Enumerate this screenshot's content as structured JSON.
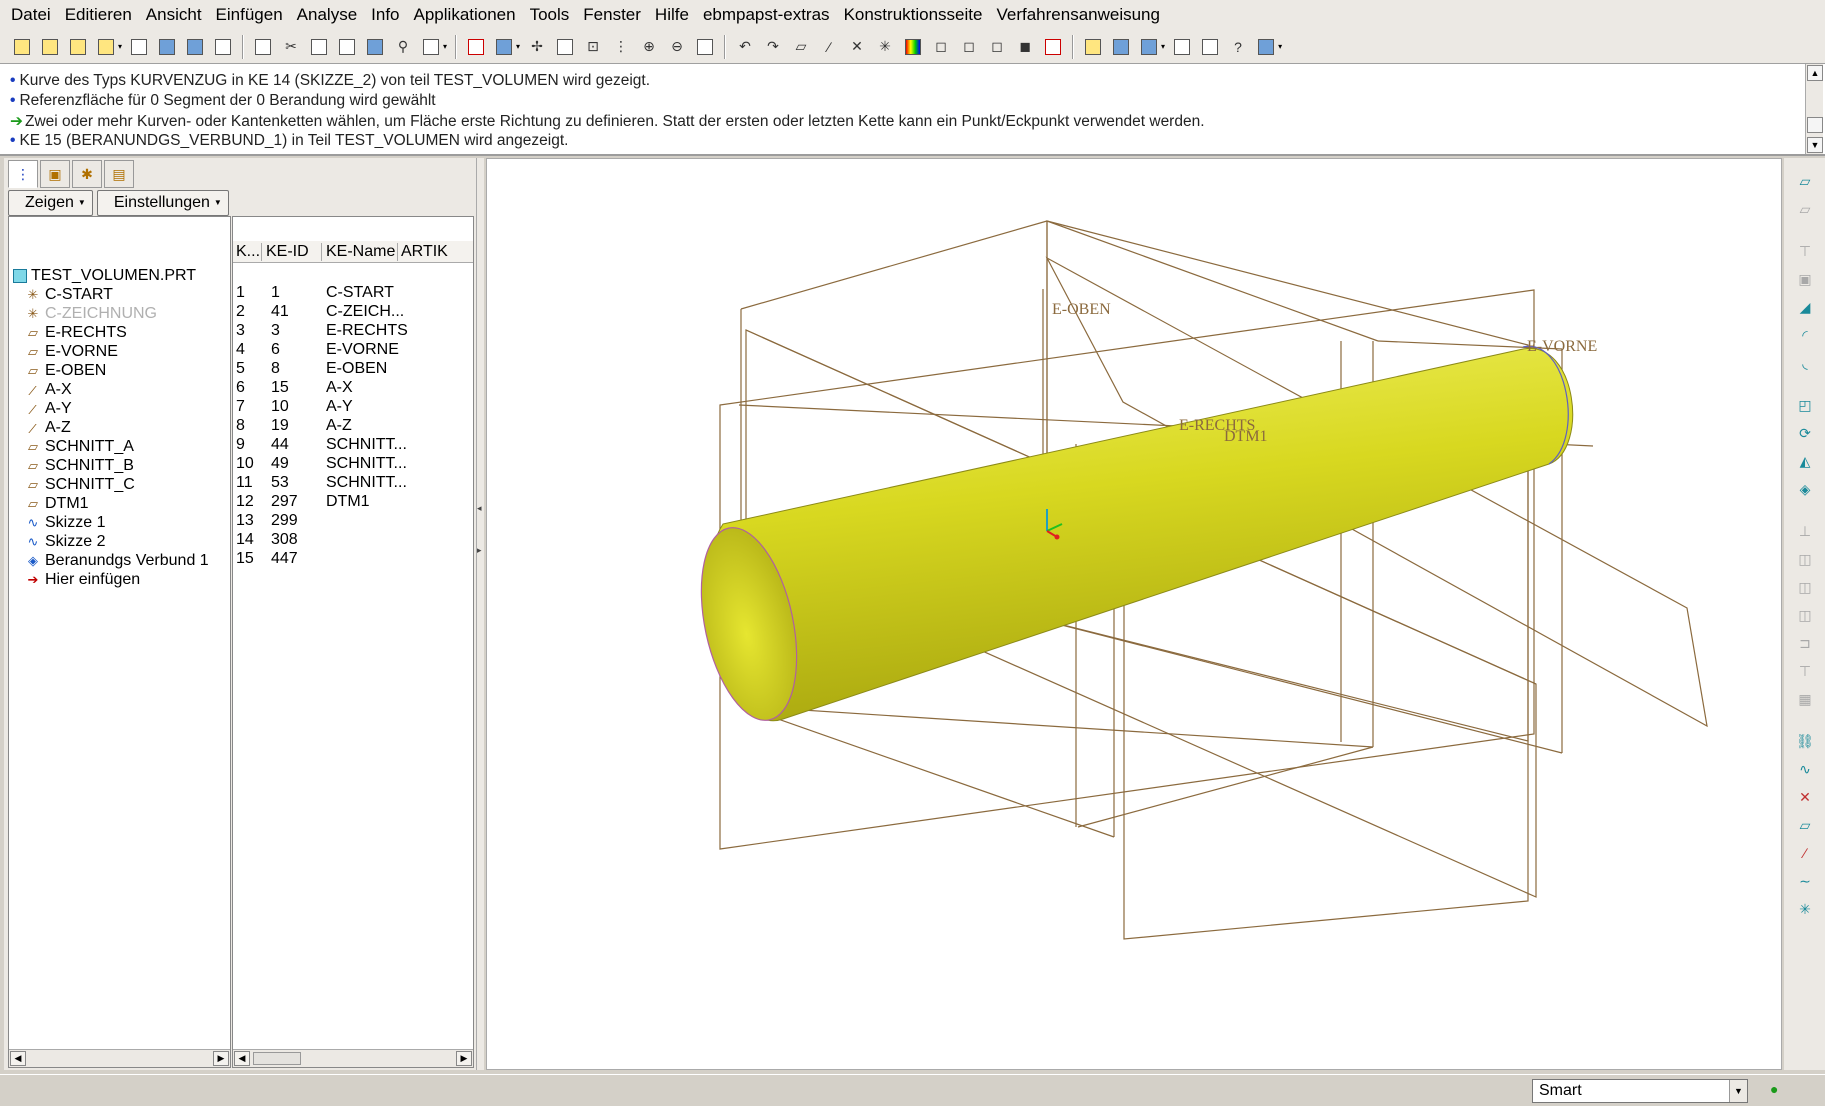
{
  "menu": [
    "Datei",
    "Editieren",
    "Ansicht",
    "Einfügen",
    "Analyse",
    "Info",
    "Applikationen",
    "Tools",
    "Fenster",
    "Hilfe",
    "ebmpapst-extras",
    "Konstruktionsseite",
    "Verfahrensanweisung"
  ],
  "messages": [
    {
      "marker": "•",
      "text": "Kurve des Typs KURVENZUG in KE 14 (SKIZZE_2) von teil TEST_VOLUMEN wird gezeigt."
    },
    {
      "marker": "•",
      "text": "Referenzfläche für 0 Segment der 0 Berandung wird gewählt"
    },
    {
      "marker": "arrow",
      "text": "Zwei oder mehr Kurven- oder Kantenketten wählen, um Fläche erste Richtung zu definieren. Statt der ersten oder letzten Kette kann ein Punkt/Eckpunkt verwendet werden."
    },
    {
      "marker": "•",
      "text": "KE 15 (BERANUNDGS_VERBUND_1) in Teil TEST_VOLUMEN wird angezeigt."
    }
  ],
  "left_panel": {
    "show_button": "Zeigen",
    "settings_button": "Einstellungen",
    "root": "TEST_VOLUMEN.PRT",
    "columns": [
      "K...",
      "KE-ID",
      "KE-Name",
      "ARTIK"
    ],
    "features": [
      {
        "name": "C-START",
        "k": "1",
        "id": "1",
        "ke_name": "C-START",
        "icon": "csys-icon",
        "glyph": "✳",
        "dim": false
      },
      {
        "name": "C-ZEICHNUNG",
        "k": "2",
        "id": "41",
        "ke_name": "C-ZEICH...",
        "icon": "csys-icon",
        "glyph": "✳",
        "dim": true
      },
      {
        "name": "E-RECHTS",
        "k": "3",
        "id": "3",
        "ke_name": "E-RECHTS",
        "icon": "datum-plane-icon",
        "glyph": "▱",
        "dim": false
      },
      {
        "name": "E-VORNE",
        "k": "4",
        "id": "6",
        "ke_name": "E-VORNE",
        "icon": "datum-plane-icon",
        "glyph": "▱",
        "dim": false
      },
      {
        "name": "E-OBEN",
        "k": "5",
        "id": "8",
        "ke_name": "E-OBEN",
        "icon": "datum-plane-icon",
        "glyph": "▱",
        "dim": false
      },
      {
        "name": "A-X",
        "k": "6",
        "id": "15",
        "ke_name": "A-X",
        "icon": "datum-axis-icon",
        "glyph": "∕",
        "dim": false
      },
      {
        "name": "A-Y",
        "k": "7",
        "id": "10",
        "ke_name": "A-Y",
        "icon": "datum-axis-icon",
        "glyph": "∕",
        "dim": false
      },
      {
        "name": "A-Z",
        "k": "8",
        "id": "19",
        "ke_name": "A-Z",
        "icon": "datum-axis-icon",
        "glyph": "∕",
        "dim": false
      },
      {
        "name": "SCHNITT_A",
        "k": "9",
        "id": "44",
        "ke_name": "SCHNITT...",
        "icon": "datum-plane-icon",
        "glyph": "▱",
        "dim": false
      },
      {
        "name": "SCHNITT_B",
        "k": "10",
        "id": "49",
        "ke_name": "SCHNITT...",
        "icon": "datum-plane-icon",
        "glyph": "▱",
        "dim": false
      },
      {
        "name": "SCHNITT_C",
        "k": "11",
        "id": "53",
        "ke_name": "SCHNITT...",
        "icon": "datum-plane-icon",
        "glyph": "▱",
        "dim": false
      },
      {
        "name": "DTM1",
        "k": "12",
        "id": "297",
        "ke_name": "DTM1",
        "icon": "datum-plane-icon",
        "glyph": "▱",
        "dim": false
      },
      {
        "name": "Skizze 1",
        "k": "13",
        "id": "299",
        "ke_name": "",
        "icon": "sketch-icon",
        "glyph": "∿",
        "dim": false
      },
      {
        "name": "Skizze 2",
        "k": "14",
        "id": "308",
        "ke_name": "",
        "icon": "sketch-icon",
        "glyph": "∿",
        "dim": false
      },
      {
        "name": "Beranundgs Verbund 1",
        "k": "15",
        "id": "447",
        "ke_name": "",
        "icon": "blend-surface-icon",
        "glyph": "◈",
        "dim": false
      }
    ],
    "insert_here": "Hier einfügen"
  },
  "graphics": {
    "labels": {
      "e_oben": "E-OBEN",
      "e_vorne": "E-VORNE",
      "e_rechts": "E-RECHTS",
      "dtm1": "DTM1"
    },
    "datum_color": "#8b6a3e",
    "body_color": "#d8d820"
  },
  "status": {
    "filter": "Smart"
  }
}
